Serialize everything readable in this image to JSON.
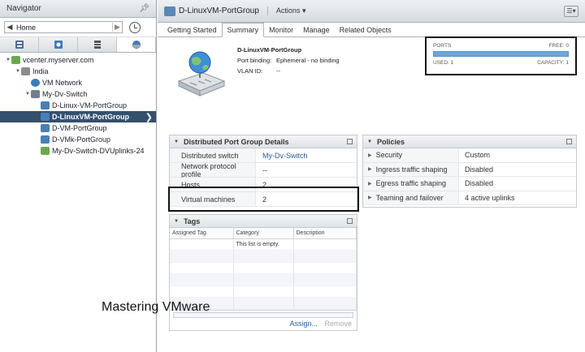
{
  "navigator": {
    "title": "Navigator",
    "home_label": "Home",
    "tabs": [
      {
        "icon": "hosts-clusters-icon",
        "color": "#4a6e93"
      },
      {
        "icon": "vms-templates-icon",
        "color": "#3d7bbd"
      },
      {
        "icon": "storage-icon",
        "color": "#555555"
      },
      {
        "icon": "networking-icon",
        "color": "#3d7bbd"
      }
    ],
    "tree": [
      {
        "label": "vcenter.myserver.com",
        "icon": "vcenter-icon",
        "depth": 0,
        "expanded": true
      },
      {
        "label": "India",
        "icon": "datacenter-icon",
        "depth": 1,
        "expanded": true
      },
      {
        "label": "VM Network",
        "icon": "network-icon",
        "depth": 2,
        "expanded": false
      },
      {
        "label": "My-Dv-Switch",
        "icon": "dvswitch-icon",
        "depth": 2,
        "expanded": true
      },
      {
        "label": "D-Linux-VM-PortGroup",
        "icon": "portgroup-icon",
        "depth": 3,
        "expanded": false
      },
      {
        "label": "D-LinuxVM-PortGroup",
        "icon": "portgroup-icon",
        "depth": 3,
        "expanded": false,
        "selected": true
      },
      {
        "label": "D-VM-PortGroup",
        "icon": "portgroup-icon",
        "depth": 3,
        "expanded": false
      },
      {
        "label": "D-VMk-PortGroup",
        "icon": "portgroup-icon",
        "depth": 3,
        "expanded": false
      },
      {
        "label": "My-Dv-Switch-DVUplinks-24",
        "icon": "uplink-portgroup-icon",
        "depth": 3,
        "expanded": false
      }
    ]
  },
  "header": {
    "title": "D-LinuxVM-PortGroup",
    "actions_label": "Actions",
    "actions_caret": "▾"
  },
  "tabs": [
    "Getting Started",
    "Summary",
    "Monitor",
    "Manage",
    "Related Objects"
  ],
  "active_tab": "Summary",
  "summary": {
    "name": "D-LinuxVM-PortGroup",
    "port_binding_label": "Port binding:",
    "port_binding_value": "Ephemeral - no binding",
    "vlan_label": "VLAN ID:",
    "vlan_value": "--"
  },
  "ports": {
    "label": "PORTS",
    "free": "FREE: 0",
    "used": "USED: 1",
    "capacity": "CAPACITY: 1",
    "used_fraction": 1.0
  },
  "details": {
    "title": "Distributed Port Group Details",
    "rows": [
      {
        "key": "Distributed switch",
        "value": "My-Dv-Switch",
        "link": true
      },
      {
        "key": "Network protocol profile",
        "value": "--",
        "link": false
      },
      {
        "key": "Hosts",
        "value": "2",
        "link": false
      },
      {
        "key": "Virtual machines",
        "value": "2",
        "link": false
      }
    ]
  },
  "policies": {
    "title": "Policies",
    "rows": [
      {
        "key": "Security",
        "value": "Custom"
      },
      {
        "key": "Ingress traffic shaping",
        "value": "Disabled"
      },
      {
        "key": "Egress traffic shaping",
        "value": "Disabled"
      },
      {
        "key": "Teaming and failover",
        "value": "4 active uplinks"
      }
    ]
  },
  "tags": {
    "title": "Tags",
    "columns": [
      "Assigned Tag",
      "Category",
      "Description"
    ],
    "empty_message": "This list is empty.",
    "assign_label": "Assign...",
    "remove_label": "Remove"
  },
  "watermark": "Mastering VMware"
}
